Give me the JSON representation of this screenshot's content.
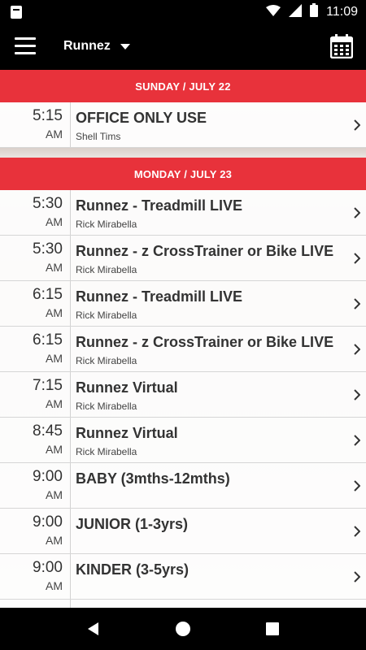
{
  "status_bar": {
    "time": "11:09",
    "icons": [
      "notification-icon",
      "wifi-icon",
      "signal-icon",
      "battery-icon"
    ]
  },
  "app_bar": {
    "title": "Runnez",
    "menu_icon": "hamburger-menu-icon",
    "calendar_icon": "calendar-icon"
  },
  "colors": {
    "accent": "#e8323b",
    "bar_bg": "#000000"
  },
  "schedule": [
    {
      "date": "SUNDAY / JULY 22",
      "classes": [
        {
          "time": "5:15",
          "ampm": "AM",
          "title": "OFFICE ONLY USE",
          "instructor": "Shell Tims"
        }
      ]
    },
    {
      "date": "MONDAY / JULY 23",
      "classes": [
        {
          "time": "5:30",
          "ampm": "AM",
          "title": "Runnez - Treadmill LIVE",
          "instructor": "Rick Mirabella"
        },
        {
          "time": "5:30",
          "ampm": "AM",
          "title": "Runnez - z CrossTrainer or Bike LIVE",
          "instructor": "Rick Mirabella"
        },
        {
          "time": "6:15",
          "ampm": "AM",
          "title": "Runnez - Treadmill LIVE",
          "instructor": "Rick Mirabella"
        },
        {
          "time": "6:15",
          "ampm": "AM",
          "title": "Runnez - z CrossTrainer or Bike LIVE",
          "instructor": "Rick Mirabella"
        },
        {
          "time": "7:15",
          "ampm": "AM",
          "title": "Runnez Virtual",
          "instructor": "Rick Mirabella"
        },
        {
          "time": "8:45",
          "ampm": "AM",
          "title": "Runnez Virtual",
          "instructor": "Rick Mirabella"
        },
        {
          "time": "9:00",
          "ampm": "AM",
          "title": "BABY (3mths-12mths)",
          "instructor": ""
        },
        {
          "time": "9:00",
          "ampm": "AM",
          "title": "JUNIOR (1-3yrs)",
          "instructor": ""
        },
        {
          "time": "9:00",
          "ampm": "AM",
          "title": "KINDER (3-5yrs)",
          "instructor": ""
        }
      ]
    }
  ],
  "nav_bar": {
    "buttons": [
      "back-icon",
      "home-icon",
      "recents-icon"
    ]
  }
}
